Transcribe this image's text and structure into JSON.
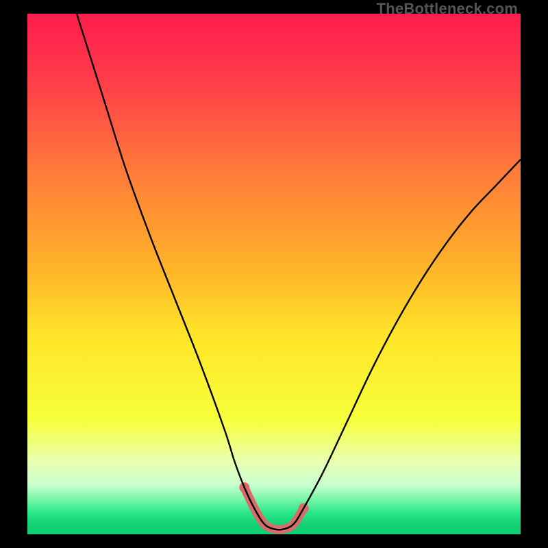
{
  "watermark": "TheBottleneck.com",
  "chart_data": {
    "type": "line",
    "title": "",
    "xlabel": "",
    "ylabel": "",
    "xlim": [
      0,
      100
    ],
    "ylim": [
      0,
      100
    ],
    "series": [
      {
        "name": "curve",
        "x": [
          10,
          15,
          20,
          25,
          30,
          35,
          40,
          42,
          44,
          46,
          48,
          50,
          52,
          54,
          56,
          60,
          65,
          70,
          75,
          80,
          85,
          90,
          95,
          100
        ],
        "values": [
          100,
          85,
          70,
          57,
          45,
          33,
          20,
          14,
          9,
          5,
          2,
          1,
          1,
          2,
          5,
          12,
          22,
          32,
          41,
          49,
          56,
          62,
          67,
          72
        ]
      }
    ],
    "highlight": {
      "name": "bottom-band",
      "x": [
        44,
        46,
        48,
        50,
        52,
        54,
        56
      ],
      "values": [
        9,
        5,
        2,
        1,
        1,
        2,
        5
      ],
      "color": "#d86b6b"
    },
    "gradient_stops": [
      {
        "offset": 0.0,
        "color": "#ff1d4d"
      },
      {
        "offset": 0.12,
        "color": "#ff3a4a"
      },
      {
        "offset": 0.3,
        "color": "#ff7a3a"
      },
      {
        "offset": 0.48,
        "color": "#ffb12a"
      },
      {
        "offset": 0.62,
        "color": "#ffe528"
      },
      {
        "offset": 0.78,
        "color": "#f7ff3a"
      },
      {
        "offset": 0.86,
        "color": "#e8ffb0"
      },
      {
        "offset": 0.905,
        "color": "#c8ffd0"
      },
      {
        "offset": 0.932,
        "color": "#7af7a8"
      },
      {
        "offset": 0.958,
        "color": "#2be88a"
      },
      {
        "offset": 0.985,
        "color": "#0fcf74"
      },
      {
        "offset": 1.0,
        "color": "#0fcf74"
      }
    ],
    "legend": null,
    "grid": false
  }
}
